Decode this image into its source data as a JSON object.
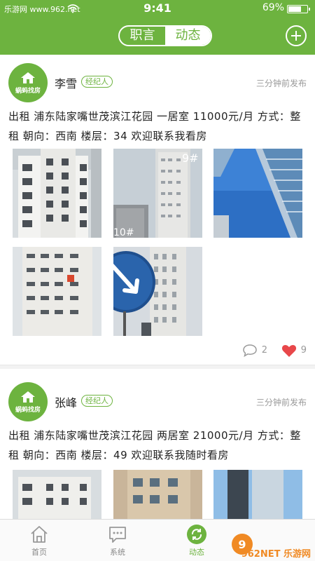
{
  "status_bar": {
    "watermark": "乐游网 www.962.net",
    "time": "9:41",
    "battery": "69%",
    "battery_level": 0.69
  },
  "header": {
    "tabs": [
      {
        "label": "职言",
        "active": false
      },
      {
        "label": "动态",
        "active": true
      }
    ],
    "add_icon": "plus-icon"
  },
  "posts": [
    {
      "user": "李雪",
      "badge": "经纪人",
      "avatar_brand": "蜗蚂找房",
      "time": "三分钟前发布",
      "text": "出租 浦东陆家嘴世茂滨江花园 一居室 11000元/月 方式：整租 朝向：西南 楼层：34 欢迎联系我看房",
      "comments": "2",
      "likes": "9"
    },
    {
      "user": "张峰",
      "badge": "经纪人",
      "avatar_brand": "蜗蚂找房",
      "time": "三分钟前发布",
      "text": "出租 浦东陆家嘴世茂滨江花园 两居室 21000元/月 方式：整租 朝向：西南 楼层：49 欢迎联系我随时看房"
    }
  ],
  "photo_labels": {
    "p2": "9#",
    "p2b": "10#"
  },
  "tabbar": {
    "items": [
      {
        "label": "首页",
        "icon": "home-icon",
        "active": false
      },
      {
        "label": "系统",
        "icon": "message-icon",
        "active": false
      },
      {
        "label": "动态",
        "icon": "refresh-icon",
        "active": true
      },
      {
        "label": "",
        "icon": "",
        "active": false
      }
    ]
  },
  "watermark": "962NET 乐游网",
  "colors": {
    "brand_green": "#6db33f",
    "like_red": "#e8474a"
  }
}
